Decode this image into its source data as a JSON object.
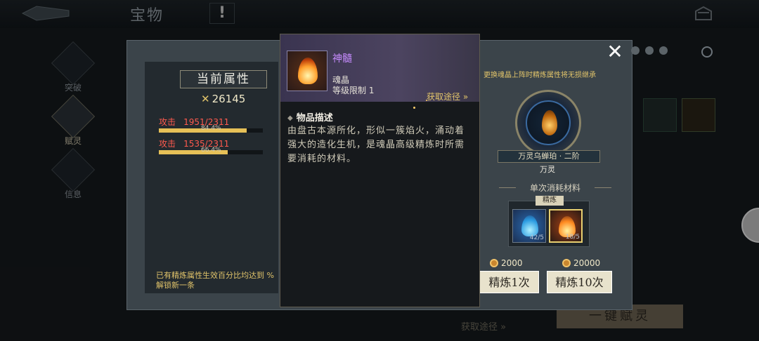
{
  "background": {
    "title": "宝物",
    "help_label": "!",
    "side_tabs": [
      {
        "label": "突破"
      },
      {
        "label": "赋灵"
      },
      {
        "label": "信息"
      }
    ],
    "bottom_source_link": "获取途径 »",
    "bottom_button": "一键赋灵"
  },
  "panel": {
    "attr_header": "当前属性",
    "power": "26145",
    "attributes": [
      {
        "name": "攻击",
        "value": "1951/2311",
        "percent_text": "84.4%",
        "fill": 0.844
      },
      {
        "name": "攻击",
        "value": "1535/2311",
        "percent_text": "66.4%",
        "fill": 0.664
      }
    ],
    "hint": "已有精炼属性生效百分比均达到 %解锁新一条",
    "replace_hint": "更换魂晶上阵时精炼属性将无损继承",
    "crystal_name": "万灵乌蝉珀 · 二阶",
    "crystal_type": "万灵",
    "consume_title": "单次消耗材料",
    "refine_tag": "精炼",
    "materials": [
      {
        "count": "42/5",
        "color": "#2a9ae0"
      },
      {
        "count": "18/5",
        "color": "#ff8a20"
      }
    ],
    "costs": [
      "2000",
      "20000"
    ],
    "buttons": [
      "精炼1次",
      "精炼10次"
    ]
  },
  "tooltip": {
    "name": "神髓",
    "category": "魂晶",
    "level_limit": "等级限制 1",
    "source": "获取途径 »",
    "section_title": "物品描述",
    "description": "由盘古本源所化，形似一簇焰火，涌动着强大的造化生机，是魂晶高级精炼时所需要消耗的材料。"
  },
  "colors": {
    "attr_red": "#ff5a4e",
    "gold": "#e0c36a",
    "item_purple": "#c78cff"
  }
}
